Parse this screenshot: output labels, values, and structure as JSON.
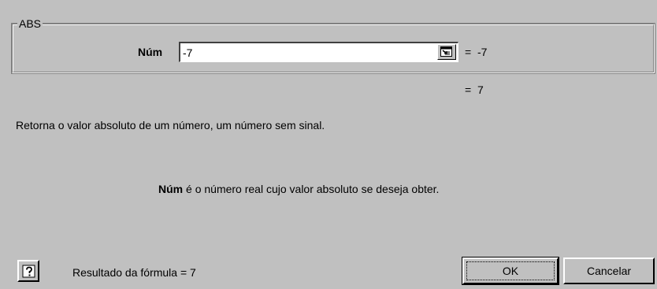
{
  "group": {
    "legend": "ABS"
  },
  "argument": {
    "label": "Núm",
    "value": "-7",
    "result": "=  -7"
  },
  "function_result": "=  7",
  "description": "Retorna o valor absoluto de um número, um número sem sinal.",
  "argument_help": {
    "name": "Núm",
    "text": " é o número real cujo valor absoluto se deseja obter."
  },
  "footer": {
    "formula_result": "Resultado da fórmula = 7",
    "ok_label": "OK",
    "cancel_label": "Cancelar"
  },
  "icons": {
    "collapse": "collapse-dialog-icon",
    "help": "question-mark-icon"
  }
}
